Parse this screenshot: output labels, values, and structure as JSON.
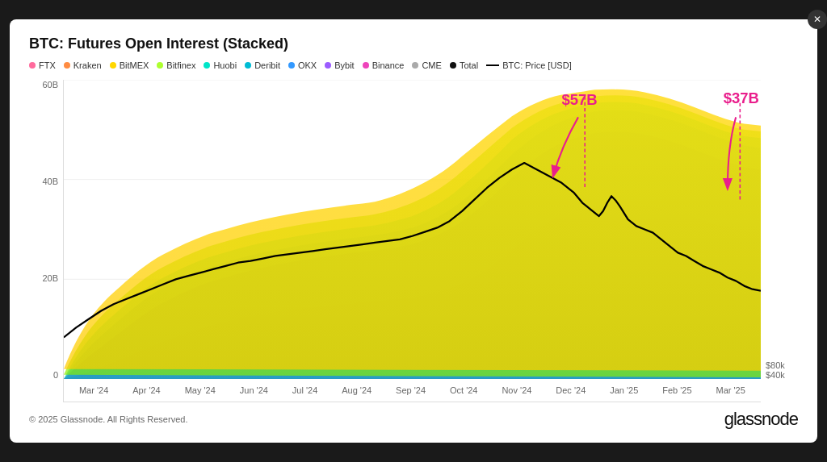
{
  "title": "BTC: Futures Open Interest (Stacked)",
  "legend": [
    {
      "label": "FTX",
      "color": "#ff6b9d",
      "type": "dot"
    },
    {
      "label": "Kraken",
      "color": "#ff8c42",
      "type": "dot"
    },
    {
      "label": "BitMEX",
      "color": "#ffd700",
      "type": "dot"
    },
    {
      "label": "Bitfinex",
      "color": "#adff2f",
      "type": "dot"
    },
    {
      "label": "Huobi",
      "color": "#00e5c8",
      "type": "dot"
    },
    {
      "label": "Deribit",
      "color": "#00bcd4",
      "type": "dot"
    },
    {
      "label": "OKX",
      "color": "#3399ff",
      "type": "dot"
    },
    {
      "label": "Bybit",
      "color": "#9c5cff",
      "type": "dot"
    },
    {
      "label": "Binance",
      "color": "#ee44bb",
      "type": "dot"
    },
    {
      "label": "CME",
      "color": "#aaaaaa",
      "type": "dot"
    },
    {
      "label": "Total",
      "color": "#111111",
      "type": "dot"
    },
    {
      "label": "BTC: Price [USD]",
      "color": "#000000",
      "type": "line"
    }
  ],
  "yAxis": {
    "left": [
      "0",
      "20B",
      "40B",
      "60B"
    ],
    "right": [
      "$40k",
      "$80k"
    ]
  },
  "xAxis": [
    "Mar '24",
    "Apr '24",
    "May '24",
    "Jun '24",
    "Jul '24",
    "Aug '24",
    "Sep '24",
    "Oct '24",
    "Nov '24",
    "Dec '24",
    "Jan '25",
    "Feb '25",
    "Mar '25"
  ],
  "annotations": {
    "high": {
      "label": "$57B",
      "position": "Dec 24"
    },
    "low": {
      "label": "$37B",
      "position": "Mar 25"
    }
  },
  "footer": {
    "copyright": "© 2025 Glassnode. All Rights Reserved.",
    "brand": "glassnode"
  },
  "close_icon": "✕"
}
